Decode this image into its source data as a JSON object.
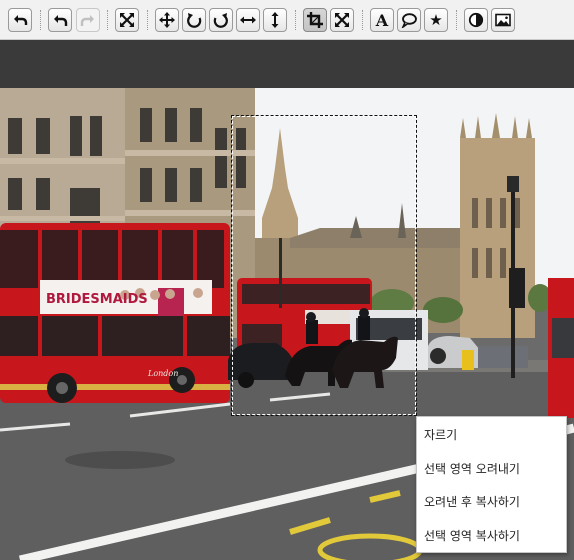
{
  "toolbar": {
    "buttons": [
      {
        "name": "undo-all-button",
        "icon": "undo-all-icon",
        "label": "Undo all"
      },
      {
        "name": "undo-button",
        "icon": "undo-icon",
        "label": "Undo"
      },
      {
        "name": "redo-button",
        "icon": "redo-icon",
        "label": "Redo",
        "enabled": false
      },
      {
        "name": "fit-button",
        "icon": "expand-icon",
        "label": "Fit"
      },
      {
        "name": "move-button",
        "icon": "move-icon",
        "label": "Move"
      },
      {
        "name": "rotate-left-button",
        "icon": "rotate-left-icon",
        "label": "Rotate left"
      },
      {
        "name": "rotate-right-button",
        "icon": "rotate-right-icon",
        "label": "Rotate right"
      },
      {
        "name": "flip-horizontal-button",
        "icon": "flip-horizontal-icon",
        "label": "Flip horizontal"
      },
      {
        "name": "flip-vertical-button",
        "icon": "flip-vertical-icon",
        "label": "Flip vertical"
      },
      {
        "name": "crop-button",
        "icon": "crop-icon",
        "label": "Crop",
        "active": true
      },
      {
        "name": "crop-fit-button",
        "icon": "crop-expand-icon",
        "label": "Crop fit"
      },
      {
        "name": "text-button",
        "icon": "text-icon",
        "glyph": "A",
        "label": "Text"
      },
      {
        "name": "speech-bubble-button",
        "icon": "speech-bubble-icon",
        "label": "Speech bubble"
      },
      {
        "name": "sticker-button",
        "icon": "star-icon",
        "glyph": "★",
        "label": "Sticker"
      },
      {
        "name": "filter-button",
        "icon": "contrast-icon",
        "label": "Filter"
      },
      {
        "name": "image-button",
        "icon": "image-icon",
        "label": "Image"
      }
    ]
  },
  "canvas": {
    "bus_ad_text": "BRIDESMAIDS",
    "bus_plate_text": "London"
  },
  "context_menu": {
    "items": [
      {
        "label": "자르기"
      },
      {
        "label": "선택 영역 오려내기"
      },
      {
        "label": "오려낸 후 복사하기"
      },
      {
        "label": "선택 영역 복사하기"
      }
    ]
  },
  "colors": {
    "toolbar_bg": "#f1f1f1",
    "workspace_bg": "#3a3a3a",
    "bus_red": "#c8161d"
  }
}
